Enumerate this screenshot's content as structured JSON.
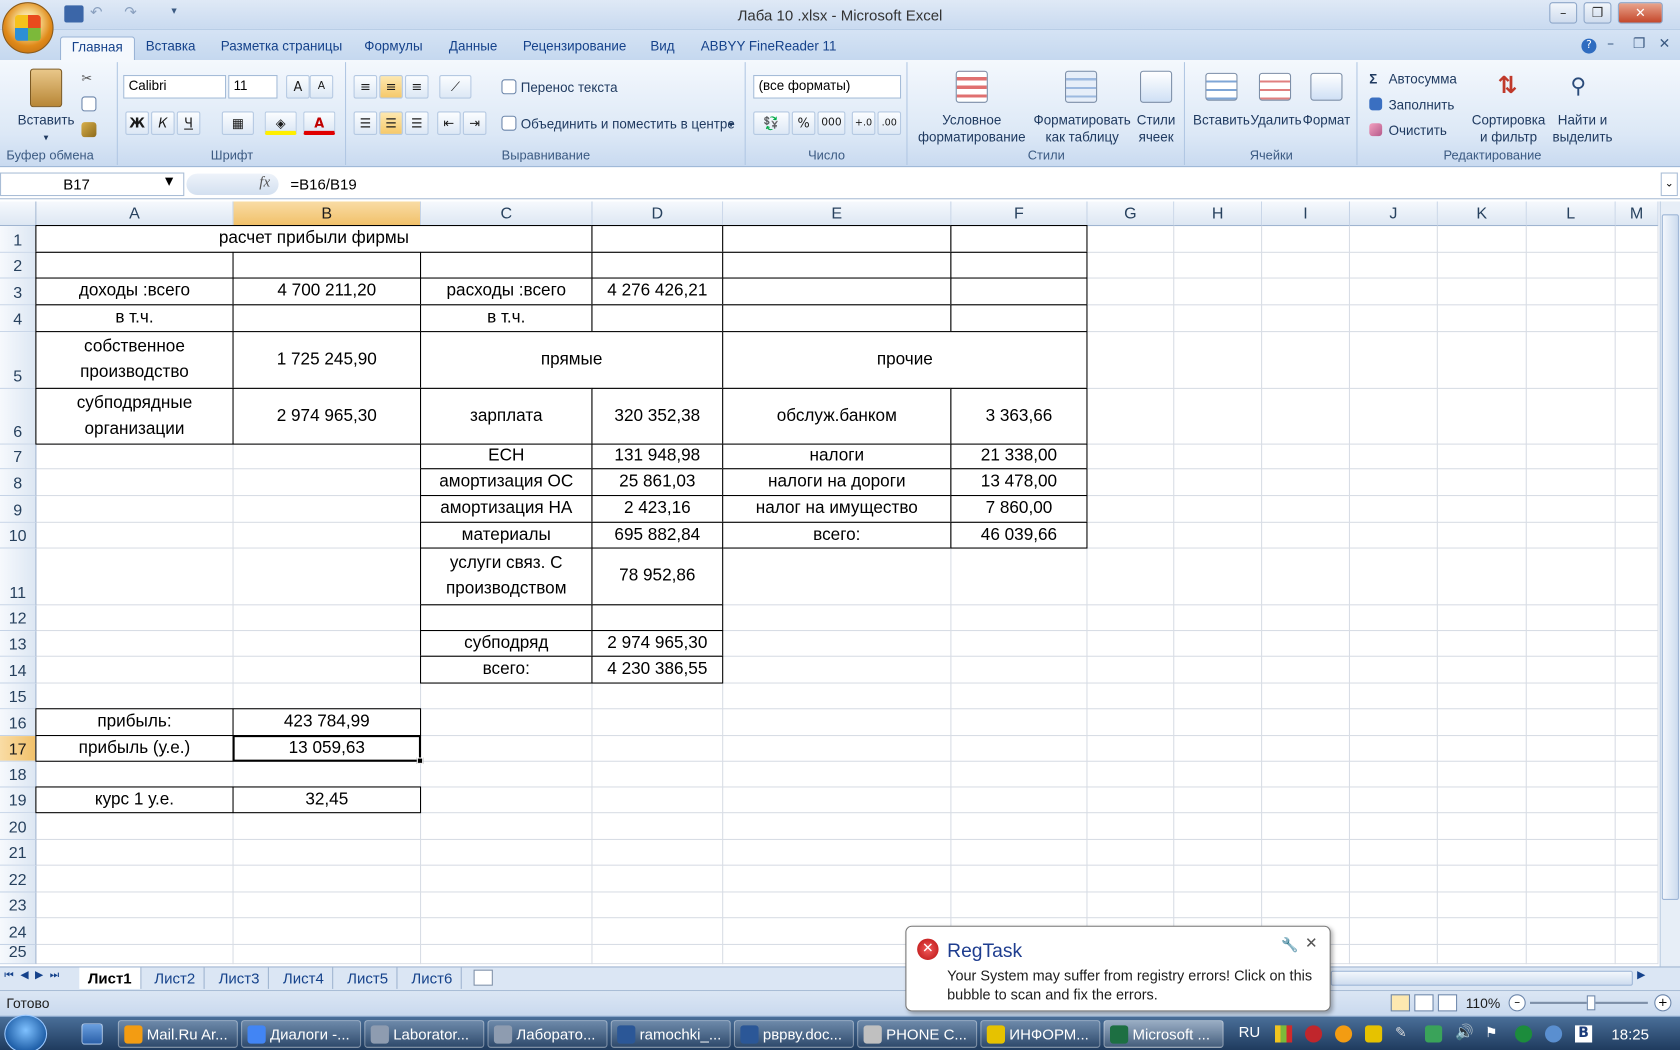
{
  "window": {
    "title": "Лаба 10 .xlsx - Microsoft Excel",
    "minimize": "–",
    "restore": "❐",
    "close": "✕"
  },
  "tabs": [
    "Главная",
    "Вставка",
    "Разметка страницы",
    "Формулы",
    "Данные",
    "Рецензирование",
    "Вид",
    "ABBYY FineReader 11"
  ],
  "ribbon": {
    "clipboard": {
      "label": "Буфер обмена",
      "paste": "Вставить"
    },
    "font": {
      "label": "Шрифт",
      "name": "Calibri",
      "size": "11",
      "bold": "Ж",
      "italic": "К",
      "underline": "Ч"
    },
    "alignment": {
      "label": "Выравнивание",
      "wrap": "Перенос текста",
      "merge": "Объединить и поместить в центре"
    },
    "number": {
      "label": "Число",
      "format": "(все форматы)",
      "percent": "%",
      "thousands": "000"
    },
    "styles": {
      "label": "Стили",
      "conditional": "Условное\nформатирование",
      "as_table": "Форматировать\nкак таблицу",
      "cell_styles": "Стили\nячеек"
    },
    "cells": {
      "label": "Ячейки",
      "insert": "Вставить",
      "delete": "Удалить",
      "format": "Формат"
    },
    "editing": {
      "label": "Редактирование",
      "autosum": "Автосумма",
      "fill": "Заполнить",
      "clear": "Очистить",
      "sort": "Сортировка\nи фильтр",
      "find": "Найти и\nвыделить"
    }
  },
  "formula_bar": {
    "name_box": "B17",
    "fx": "fx",
    "formula": "=B16/B19"
  },
  "columns": [
    "A",
    "B",
    "C",
    "D",
    "E",
    "F",
    "G",
    "H",
    "I",
    "J",
    "K",
    "L",
    "M"
  ],
  "rows": [
    "1",
    "2",
    "3",
    "4",
    "5",
    "6",
    "7",
    "8",
    "9",
    "10",
    "11",
    "12",
    "13",
    "14",
    "15",
    "16",
    "17",
    "18",
    "19",
    "20",
    "21",
    "22",
    "23",
    "24",
    "25"
  ],
  "cells": {
    "title": "расчет прибыли фирмы",
    "A3": "доходы :всего",
    "B3": "4 700 211,20",
    "C3": "расходы :всего",
    "D3": "4 276 426,21",
    "A4": "в т.ч.",
    "C4": "в т.ч.",
    "A5": "собственное\nпроизводство",
    "B5": "1 725 245,90",
    "C5": "прямые",
    "E5": "прочие",
    "A6": "субподрядные\nорганизации",
    "B6": "2 974 965,30",
    "C6": "зарплата",
    "D6": "320 352,38",
    "E6": "обслуж.банком",
    "F6": "3 363,66",
    "C7": "ЕСН",
    "D7": "131 948,98",
    "E7": "налоги",
    "F7": "21 338,00",
    "C8": "амортизация ОС",
    "D8": "25 861,03",
    "E8": "налоги на дороги",
    "F8": "13 478,00",
    "C9": "амортизация НА",
    "D9": "2 423,16",
    "E9": "налог на имущество",
    "F9": "7 860,00",
    "C10": "материалы",
    "D10": "695 882,84",
    "E10": "всего:",
    "F10": "46 039,66",
    "C11": "услуги связ. С\nпроизводством",
    "D11": "78 952,86",
    "C13": "субподряд",
    "D13": "2 974 965,30",
    "C14": "всего:",
    "D14": "4 230 386,55",
    "A16": "прибыль:",
    "B16": "423 784,99",
    "A17": "прибыль (у.е.)",
    "B17": "13 059,63",
    "A19": "курс 1 у.е.",
    "B19": "32,45"
  },
  "sheets": [
    "Лист1",
    "Лист2",
    "Лист3",
    "Лист4",
    "Лист5",
    "Лист6"
  ],
  "status": {
    "ready": "Готово",
    "zoom": "110%"
  },
  "balloon": {
    "title": "RegTask",
    "text": "Your System may suffer from registry errors! Click on this bubble to scan and fix the errors."
  },
  "taskbar": {
    "items": [
      "Mail.Ru Ar...",
      "Диалоги -...",
      "Laborator...",
      "Лаборато...",
      "ramochki_...",
      "рврву.doc...",
      "PHONE C...",
      "ИНФОРМ...",
      "Microsoft ..."
    ],
    "lang": "RU",
    "clock": "18:25"
  }
}
